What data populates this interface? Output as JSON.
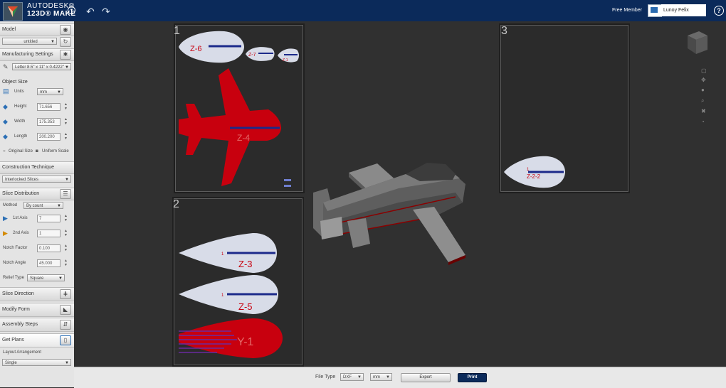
{
  "app": {
    "brand_top": "AUTODESK®",
    "brand_bottom": "123D® MAKE"
  },
  "topbar": {
    "member": "Free Member",
    "user": "Lunoy Felix"
  },
  "sidebar": {
    "model": {
      "title": "Model",
      "value": "untitled"
    },
    "manufacturing": {
      "title": "Manufacturing Settings",
      "value": "Letter 8.5\" x 11\" x 0.4222\""
    },
    "object_size": {
      "title": "Object Size",
      "units_label": "Units",
      "units_value": "mm",
      "height_label": "Height",
      "height_value": "71.656",
      "width_label": "Width",
      "width_value": "175.353",
      "length_label": "Length",
      "length_value": "200.200",
      "original_size": "Original Size",
      "uniform_scale": "Uniform Scale"
    },
    "construction": {
      "title": "Construction Technique",
      "value": "Interlocked Slices"
    },
    "slice_dist": {
      "title": "Slice Distribution",
      "method_label": "Method",
      "method_value": "By count",
      "axis1_label": "1st Axis",
      "axis1_value": "7",
      "axis2_label": "2nd Axis",
      "axis2_value": "1",
      "notch_factor_label": "Notch Factor",
      "notch_factor_value": "0.100",
      "notch_angle_label": "Notch Angle",
      "notch_angle_value": "45.000",
      "relief_label": "Relief Type",
      "relief_value": "Square"
    },
    "slice_direction": "Slice Direction",
    "modify_form": "Modify Form",
    "assembly": "Assembly Steps",
    "get_plans": {
      "title": "Get Plans",
      "layout_label": "Layout Arrangement",
      "layout_value": "Single"
    }
  },
  "sheets": {
    "s1": {
      "num": "1",
      "parts": [
        "Z-6",
        "Z-7",
        "Z-1",
        "Z-4"
      ]
    },
    "s2": {
      "num": "2",
      "parts": [
        "Z-3",
        "Z-5",
        "Y-1"
      ]
    },
    "s3": {
      "num": "3",
      "parts": [
        "Z-2-2"
      ]
    },
    "part_index": "1"
  },
  "bottombar": {
    "file_type_label": "File Type",
    "file_type": "DXF",
    "unit": "mm",
    "export": "Export",
    "print": "Print"
  },
  "colors": {
    "accent": "#0b2a5a",
    "part_fill": "#d8dce8",
    "part_red": "#c8000e",
    "slot": "#1c2a8a"
  }
}
